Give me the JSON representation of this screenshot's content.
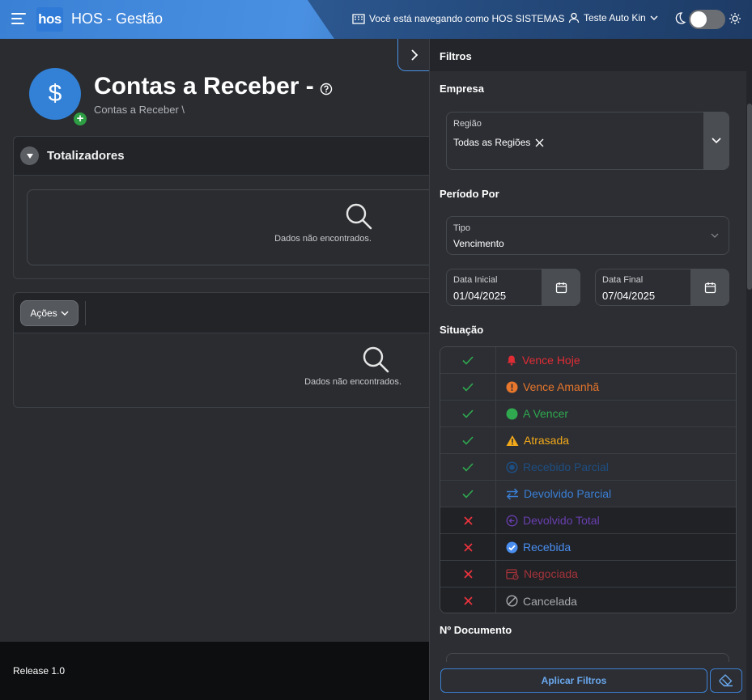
{
  "header": {
    "logo": "hos",
    "app_title": "HOS - Gestão",
    "browse_info": "Você está navegando como HOS SISTEMAS",
    "user_name": "Teste Auto Kin"
  },
  "page": {
    "title": "Contas a Receber -",
    "breadcrumb": "Contas a Receber  \\",
    "icon_symbol": "$"
  },
  "totalizers": {
    "title": "Totalizadores",
    "empty_text": "Dados não encontrados."
  },
  "actions": {
    "button_label": "Ações",
    "empty_text": "Dados não encontrados."
  },
  "footer": {
    "release": "Release 1.0"
  },
  "filters": {
    "title": "Filtros",
    "empresa_label": "Empresa",
    "regiao_label": "Região",
    "regiao_value": "Todas as Regiões",
    "periodo_label": "Período Por",
    "tipo_label": "Tipo",
    "tipo_value": "Vencimento",
    "data_inicial_label": "Data Inicial",
    "data_inicial_value": "01/04/2025",
    "data_final_label": "Data Final",
    "data_final_value": "07/04/2025",
    "situacao_label": "Situação",
    "documento_label": "Nº Documento",
    "apply_label": "Aplicar Filtros",
    "status": [
      {
        "label": "Vence Hoje",
        "checked": true,
        "color": "#e02c35",
        "icon": "bell-icon"
      },
      {
        "label": "Vence Amanhã",
        "checked": true,
        "color": "#e8762c",
        "icon": "exclamation-circle-icon"
      },
      {
        "label": "A Vencer",
        "checked": true,
        "color": "#2fa84f",
        "icon": "circle-icon"
      },
      {
        "label": "Atrasada",
        "checked": true,
        "color": "#f2a91a",
        "icon": "warning-triangle-icon"
      },
      {
        "label": "Recebido Parcial",
        "checked": true,
        "color": "#1e4e82",
        "icon": "radio-circle-icon"
      },
      {
        "label": "Devolvido Parcial",
        "checked": true,
        "color": "#3a7fd5",
        "icon": "swap-arrows-icon"
      },
      {
        "label": "Devolvido Total",
        "checked": false,
        "color": "#6a3fb0",
        "icon": "return-circle-icon"
      },
      {
        "label": "Recebida",
        "checked": false,
        "color": "#4a8ef0",
        "icon": "check-circle-icon"
      },
      {
        "label": "Negociada",
        "checked": false,
        "color": "#a6333a",
        "icon": "calendar-clock-icon"
      },
      {
        "label": "Cancelada",
        "checked": false,
        "color": "#a7a9ad",
        "icon": "ban-icon"
      }
    ]
  }
}
